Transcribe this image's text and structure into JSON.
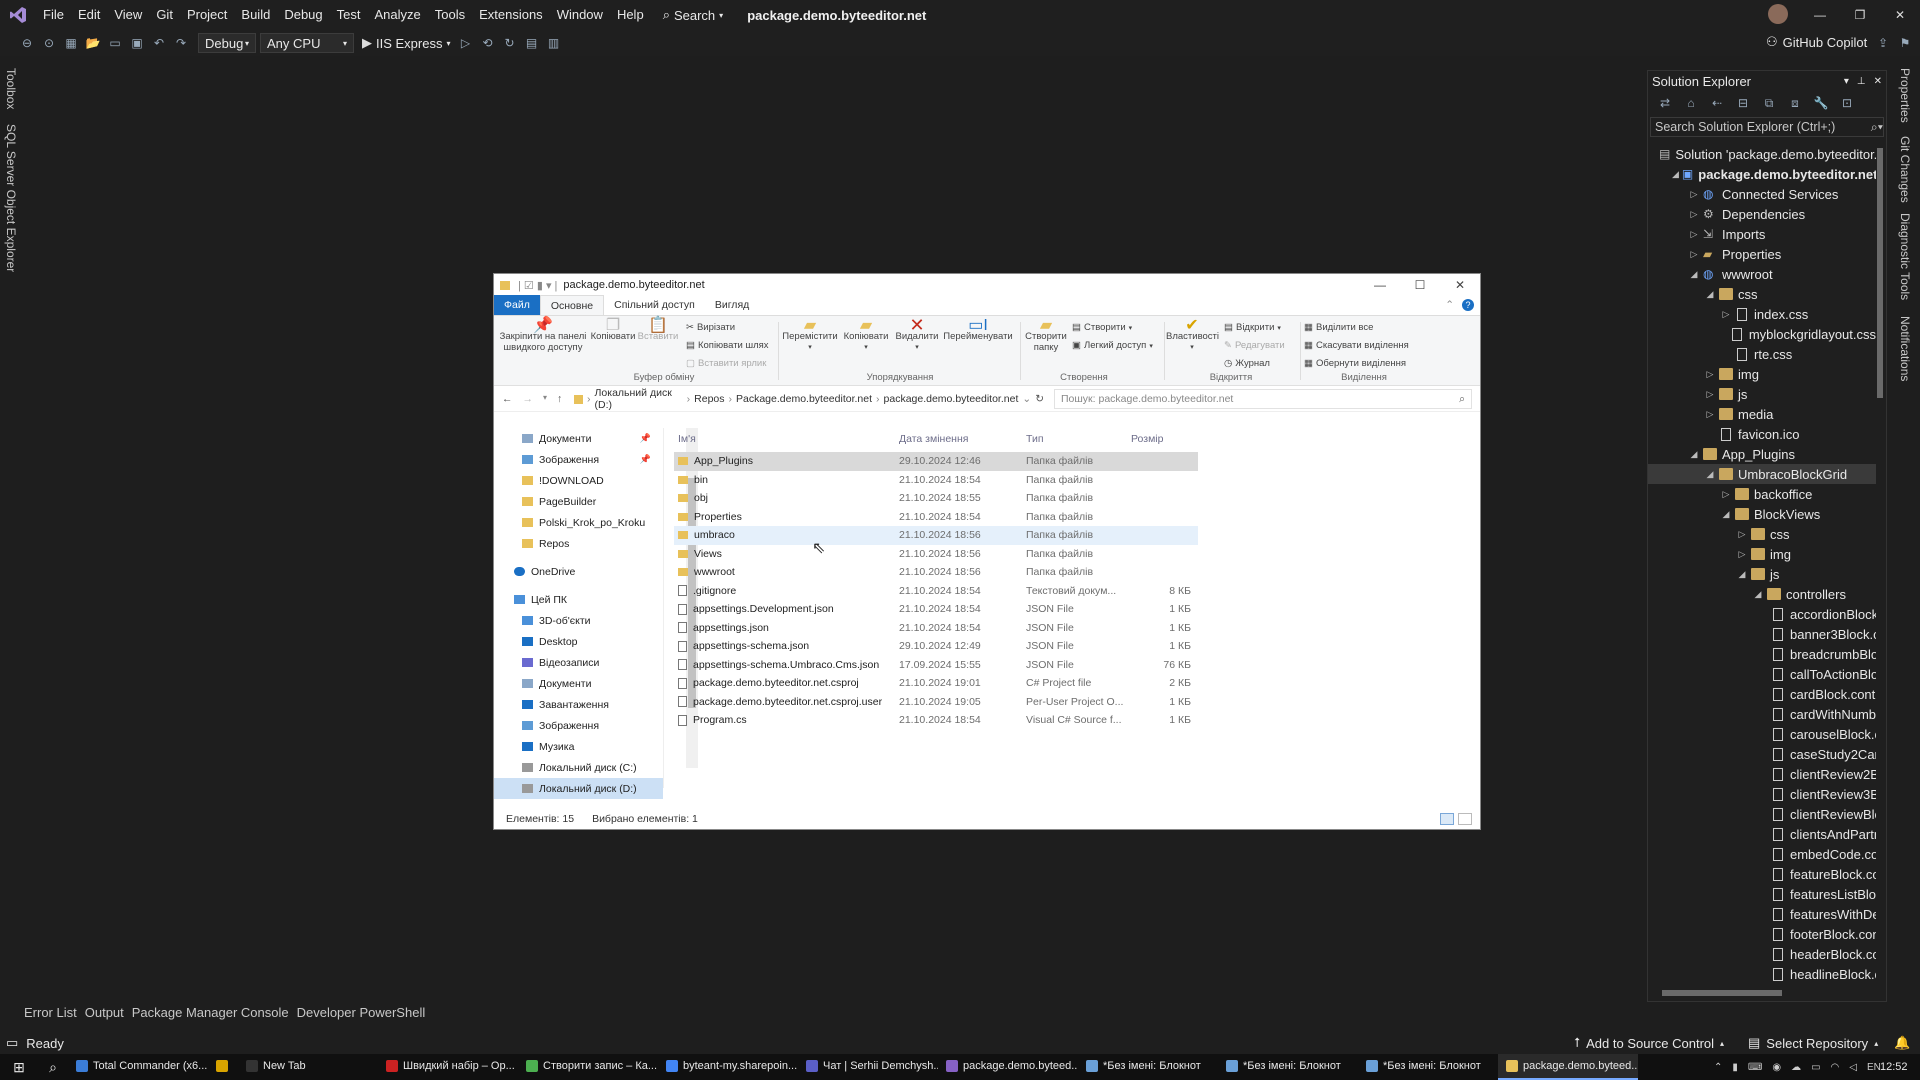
{
  "titlebar": {
    "menu": [
      "File",
      "Edit",
      "View",
      "Git",
      "Project",
      "Build",
      "Debug",
      "Test",
      "Analyze",
      "Tools",
      "Extensions",
      "Window",
      "Help"
    ],
    "search_label": "Search",
    "project_title": "package.demo.byteeditor.net"
  },
  "toolbar": {
    "config": "Debug",
    "platform": "Any CPU",
    "run_target": "IIS Express",
    "copilot": "GitHub Copilot"
  },
  "left_tabs": [
    "Toolbox",
    "SQL Server Object Explorer"
  ],
  "right_tabs": [
    "Properties",
    "Git Changes",
    "Diagnostic Tools",
    "Notifications"
  ],
  "solution_explorer": {
    "title": "Solution Explorer",
    "search_placeholder": "Search Solution Explorer (Ctrl+;)",
    "tree": [
      {
        "label": "Solution 'package.demo.byteeditor.",
        "indent": 0,
        "icon": "solution",
        "tw": ""
      },
      {
        "label": "package.demo.byteeditor.net",
        "indent": 1,
        "icon": "project",
        "tw": "◢",
        "bold": true
      },
      {
        "label": "Connected Services",
        "indent": 2,
        "icon": "globe",
        "tw": "▷"
      },
      {
        "label": "Dependencies",
        "indent": 2,
        "icon": "deps",
        "tw": "▷"
      },
      {
        "label": "Imports",
        "indent": 2,
        "icon": "imports",
        "tw": "▷"
      },
      {
        "label": "Properties",
        "indent": 2,
        "icon": "gear",
        "tw": "▷"
      },
      {
        "label": "wwwroot",
        "indent": 2,
        "icon": "globe",
        "tw": "◢"
      },
      {
        "label": "css",
        "indent": 3,
        "icon": "folder",
        "tw": "◢"
      },
      {
        "label": "index.css",
        "indent": 4,
        "icon": "file",
        "tw": "▷"
      },
      {
        "label": "myblockgridlayout.css",
        "indent": 4,
        "icon": "file",
        "tw": ""
      },
      {
        "label": "rte.css",
        "indent": 4,
        "icon": "file",
        "tw": ""
      },
      {
        "label": "img",
        "indent": 3,
        "icon": "folder",
        "tw": "▷"
      },
      {
        "label": "js",
        "indent": 3,
        "icon": "folder",
        "tw": "▷"
      },
      {
        "label": "media",
        "indent": 3,
        "icon": "folder",
        "tw": "▷"
      },
      {
        "label": "favicon.ico",
        "indent": 3,
        "icon": "file",
        "tw": ""
      },
      {
        "label": "App_Plugins",
        "indent": 2,
        "icon": "folder",
        "tw": "◢"
      },
      {
        "label": "UmbracoBlockGrid",
        "indent": 3,
        "icon": "folder",
        "tw": "◢",
        "sel": true
      },
      {
        "label": "backoffice",
        "indent": 4,
        "icon": "folder",
        "tw": "▷"
      },
      {
        "label": "BlockViews",
        "indent": 4,
        "icon": "folder",
        "tw": "◢"
      },
      {
        "label": "css",
        "indent": 5,
        "icon": "folder",
        "tw": "▷"
      },
      {
        "label": "img",
        "indent": 5,
        "icon": "folder",
        "tw": "▷"
      },
      {
        "label": "js",
        "indent": 5,
        "icon": "folder",
        "tw": "◢"
      },
      {
        "label": "controllers",
        "indent": 6,
        "icon": "folder",
        "tw": "◢"
      },
      {
        "label": "accordionBlock",
        "indent": 7,
        "icon": "file",
        "tw": ""
      },
      {
        "label": "banner3Block.c",
        "indent": 7,
        "icon": "file",
        "tw": ""
      },
      {
        "label": "breadcrumbBlo",
        "indent": 7,
        "icon": "file",
        "tw": ""
      },
      {
        "label": "callToActionBlo",
        "indent": 7,
        "icon": "file",
        "tw": ""
      },
      {
        "label": "cardBlock.contr",
        "indent": 7,
        "icon": "file",
        "tw": ""
      },
      {
        "label": "cardWithNumb",
        "indent": 7,
        "icon": "file",
        "tw": ""
      },
      {
        "label": "carouselBlock.c",
        "indent": 7,
        "icon": "file",
        "tw": ""
      },
      {
        "label": "caseStudy2Carc",
        "indent": 7,
        "icon": "file",
        "tw": ""
      },
      {
        "label": "clientReview2Bl",
        "indent": 7,
        "icon": "file",
        "tw": ""
      },
      {
        "label": "clientReview3Bl",
        "indent": 7,
        "icon": "file",
        "tw": ""
      },
      {
        "label": "clientReviewBlo",
        "indent": 7,
        "icon": "file",
        "tw": ""
      },
      {
        "label": "clientsAndPartn",
        "indent": 7,
        "icon": "file",
        "tw": ""
      },
      {
        "label": "embedCode.co",
        "indent": 7,
        "icon": "file",
        "tw": ""
      },
      {
        "label": "featureBlock.co",
        "indent": 7,
        "icon": "file",
        "tw": ""
      },
      {
        "label": "featuresListBloc",
        "indent": 7,
        "icon": "file",
        "tw": ""
      },
      {
        "label": "featuresWithDe",
        "indent": 7,
        "icon": "file",
        "tw": ""
      },
      {
        "label": "footerBlock.con",
        "indent": 7,
        "icon": "file",
        "tw": ""
      },
      {
        "label": "headerBlock.co",
        "indent": 7,
        "icon": "file",
        "tw": ""
      },
      {
        "label": "headlineBlock.c",
        "indent": 7,
        "icon": "file",
        "tw": ""
      }
    ]
  },
  "bottom_tabs": [
    "Error List",
    "Output",
    "Package Manager Console",
    "Developer PowerShell"
  ],
  "status": {
    "ready": "Ready",
    "add_source": "Add to Source Control",
    "select_repo": "Select Repository"
  },
  "taskbar": {
    "items": [
      {
        "label": "Total Commander (x6...",
        "color": "#3b7dd8",
        "active": false
      },
      {
        "label": "",
        "color": "#d9a400",
        "active": false,
        "narrow": true
      },
      {
        "label": "New Tab",
        "color": "#333",
        "active": false
      },
      {
        "label": "Швидкий набір – Op...",
        "color": "#cc2222",
        "active": false
      },
      {
        "label": "Створити запис – Ка...",
        "color": "#4caf50",
        "active": false
      },
      {
        "label": "byteant-my.sharepoin...",
        "color": "#4285f4",
        "active": false
      },
      {
        "label": "Чат | Serhii Demchysh...",
        "color": "#5b5fc7",
        "active": false
      },
      {
        "label": "package.demo.byteed...",
        "color": "#8661c5",
        "active": false
      },
      {
        "label": "*Без імені: Блокнот",
        "color": "#6aa0d8",
        "active": false
      },
      {
        "label": "*Без імені: Блокнот",
        "color": "#6aa0d8",
        "active": false
      },
      {
        "label": "*Без імені: Блокнот",
        "color": "#6aa0d8",
        "active": false
      },
      {
        "label": "package.demo.byteed...",
        "color": "#e8c15a",
        "active": true
      }
    ],
    "time": "12:52"
  },
  "explorer": {
    "title": "package.demo.byteeditor.net",
    "tabs": [
      "Файл",
      "Основне",
      "Спільний доступ",
      "Вигляд"
    ],
    "ribbon": {
      "pin": "Закріпити на панелі швидкого доступу",
      "copy": "Копіювати",
      "paste": "Вставити",
      "cut": "Вирізати",
      "copy_path": "Копіювати шлях",
      "paste_shortcut": "Вставити ярлик",
      "clipboard_group": "Буфер обміну",
      "move": "Перемістити",
      "copy2": "Копіювати",
      "delete": "Видалити",
      "rename": "Перейменувати",
      "organize_group": "Упорядкування",
      "new_folder": "Створити папку",
      "new_item": "Створити",
      "easy_access": "Легкий доступ",
      "create_group": "Створення",
      "properties": "Властивості",
      "open": "Відкрити",
      "edit": "Редагувати",
      "history": "Журнал",
      "open_group": "Відкриття",
      "select_all": "Виділити все",
      "select_none": "Скасувати виділення",
      "invert": "Обернути виділення",
      "select_group": "Виділення"
    },
    "breadcrumb": [
      "Локальний диск (D:)",
      "Repos",
      "Package.demo.byteeditor.net",
      "package.demo.byteeditor.net"
    ],
    "search_placeholder": "Пошук: package.demo.byteeditor.net",
    "nav": [
      {
        "label": "Документи",
        "pin": true,
        "type": "doc"
      },
      {
        "label": "Зображення",
        "pin": true,
        "type": "img"
      },
      {
        "label": "!DOWNLOAD",
        "type": "folder"
      },
      {
        "label": "PageBuilder",
        "type": "folder"
      },
      {
        "label": "Polski_Krok_po_Kroku",
        "type": "folder"
      },
      {
        "label": "Repos",
        "type": "folder"
      },
      {
        "label": "",
        "type": "gap"
      },
      {
        "label": "OneDrive",
        "type": "cloud",
        "lvl": 0
      },
      {
        "label": "",
        "type": "gap"
      },
      {
        "label": "Цей ПК",
        "type": "pc",
        "lvl": 0
      },
      {
        "label": "3D-об'єкти",
        "type": "obj"
      },
      {
        "label": "Desktop",
        "type": "desk"
      },
      {
        "label": "Відеозаписи",
        "type": "video"
      },
      {
        "label": "Документи",
        "type": "doc"
      },
      {
        "label": "Завантаження",
        "type": "down"
      },
      {
        "label": "Зображення",
        "type": "img"
      },
      {
        "label": "Музика",
        "type": "music"
      },
      {
        "label": "Локальний диск (C:)",
        "type": "drive"
      },
      {
        "label": "Локальний диск (D:)",
        "type": "drive",
        "sel": true
      }
    ],
    "columns": [
      "Ім'я",
      "Дата змінення",
      "Тип",
      "Розмір"
    ],
    "files": [
      {
        "name": "App_Plugins",
        "date": "29.10.2024 12:46",
        "type": "Папка файлів",
        "size": "",
        "folder": true,
        "state": "sel"
      },
      {
        "name": "bin",
        "date": "21.10.2024 18:54",
        "type": "Папка файлів",
        "size": "",
        "folder": true
      },
      {
        "name": "obj",
        "date": "21.10.2024 18:55",
        "type": "Папка файлів",
        "size": "",
        "folder": true
      },
      {
        "name": "Properties",
        "date": "21.10.2024 18:54",
        "type": "Папка файлів",
        "size": "",
        "folder": true
      },
      {
        "name": "umbraco",
        "date": "21.10.2024 18:56",
        "type": "Папка файлів",
        "size": "",
        "folder": true,
        "state": "hov"
      },
      {
        "name": "Views",
        "date": "21.10.2024 18:56",
        "type": "Папка файлів",
        "size": "",
        "folder": true
      },
      {
        "name": "wwwroot",
        "date": "21.10.2024 18:56",
        "type": "Папка файлів",
        "size": "",
        "folder": true
      },
      {
        "name": ".gitignore",
        "date": "21.10.2024 18:54",
        "type": "Текстовий докум...",
        "size": "8 КБ"
      },
      {
        "name": "appsettings.Development.json",
        "date": "21.10.2024 18:54",
        "type": "JSON File",
        "size": "1 КБ"
      },
      {
        "name": "appsettings.json",
        "date": "21.10.2024 18:54",
        "type": "JSON File",
        "size": "1 КБ"
      },
      {
        "name": "appsettings-schema.json",
        "date": "29.10.2024 12:49",
        "type": "JSON File",
        "size": "1 КБ"
      },
      {
        "name": "appsettings-schema.Umbraco.Cms.json",
        "date": "17.09.2024 15:55",
        "type": "JSON File",
        "size": "76 КБ"
      },
      {
        "name": "package.demo.byteeditor.net.csproj",
        "date": "21.10.2024 19:01",
        "type": "C# Project file",
        "size": "2 КБ"
      },
      {
        "name": "package.demo.byteeditor.net.csproj.user",
        "date": "21.10.2024 19:05",
        "type": "Per-User Project O...",
        "size": "1 КБ"
      },
      {
        "name": "Program.cs",
        "date": "21.10.2024 18:54",
        "type": "Visual C# Source f...",
        "size": "1 КБ"
      }
    ],
    "status_count": "Елементів: 15",
    "status_selected": "Вибрано елементів: 1"
  }
}
